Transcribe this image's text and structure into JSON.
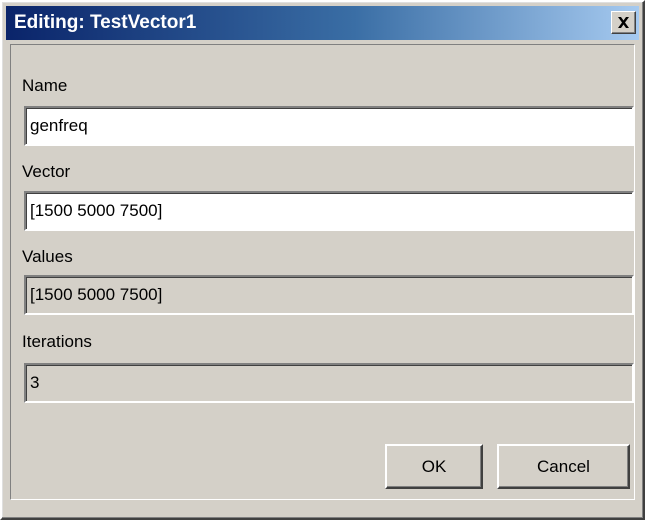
{
  "window": {
    "title": "Editing: TestVector1",
    "close_glyph": "×",
    "close_icon": "close-icon"
  },
  "form": {
    "name_label": "Name",
    "name_value": "genfreq",
    "vector_label": "Vector",
    "vector_value": "[1500 5000 7500]",
    "values_label": "Values",
    "values_value": "[1500 5000 7500]",
    "iterations_label": "Iterations",
    "iterations_value": "3"
  },
  "buttons": {
    "ok_label": "OK",
    "cancel_label": "Cancel"
  },
  "colors": {
    "title_gradient_start": "#0a246a",
    "title_gradient_end": "#a6caf0",
    "face": "#d4d0c8"
  }
}
